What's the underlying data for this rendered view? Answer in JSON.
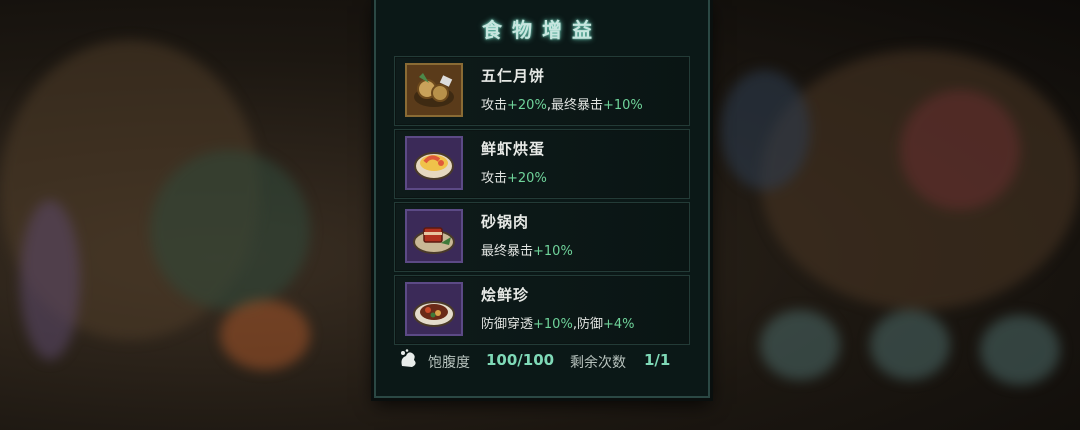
{
  "panel": {
    "title": "食物增益",
    "foods": [
      {
        "name": "五仁月饼",
        "effect_parts": [
          "攻击",
          "+20%",
          ",最终暴击",
          "+10%"
        ],
        "icon": "mooncake-icon",
        "frame_color": "orange"
      },
      {
        "name": "鲜虾烘蛋",
        "effect_parts": [
          "攻击",
          "+20%",
          "",
          ""
        ],
        "icon": "shrimp-egg-icon",
        "frame_color": "purple"
      },
      {
        "name": "砂锅肉",
        "effect_parts": [
          "最终暴击",
          "+10%",
          "",
          ""
        ],
        "icon": "clay-pot-meat-icon",
        "frame_color": "purple"
      },
      {
        "name": "烩鲜珍",
        "effect_parts": [
          "防御穿透",
          "+10%",
          ",防御",
          "+4%"
        ],
        "icon": "braised-delicacy-icon",
        "frame_color": "purple"
      }
    ]
  },
  "footer": {
    "satiety_label": "饱腹度",
    "satiety_value": "100/100",
    "remaining_label": "剩余次数",
    "remaining_value": "1/1",
    "icon": "stomach-icon"
  },
  "colors": {
    "value_green": "#6fd39a",
    "title_glow": "#5fb9a6"
  }
}
